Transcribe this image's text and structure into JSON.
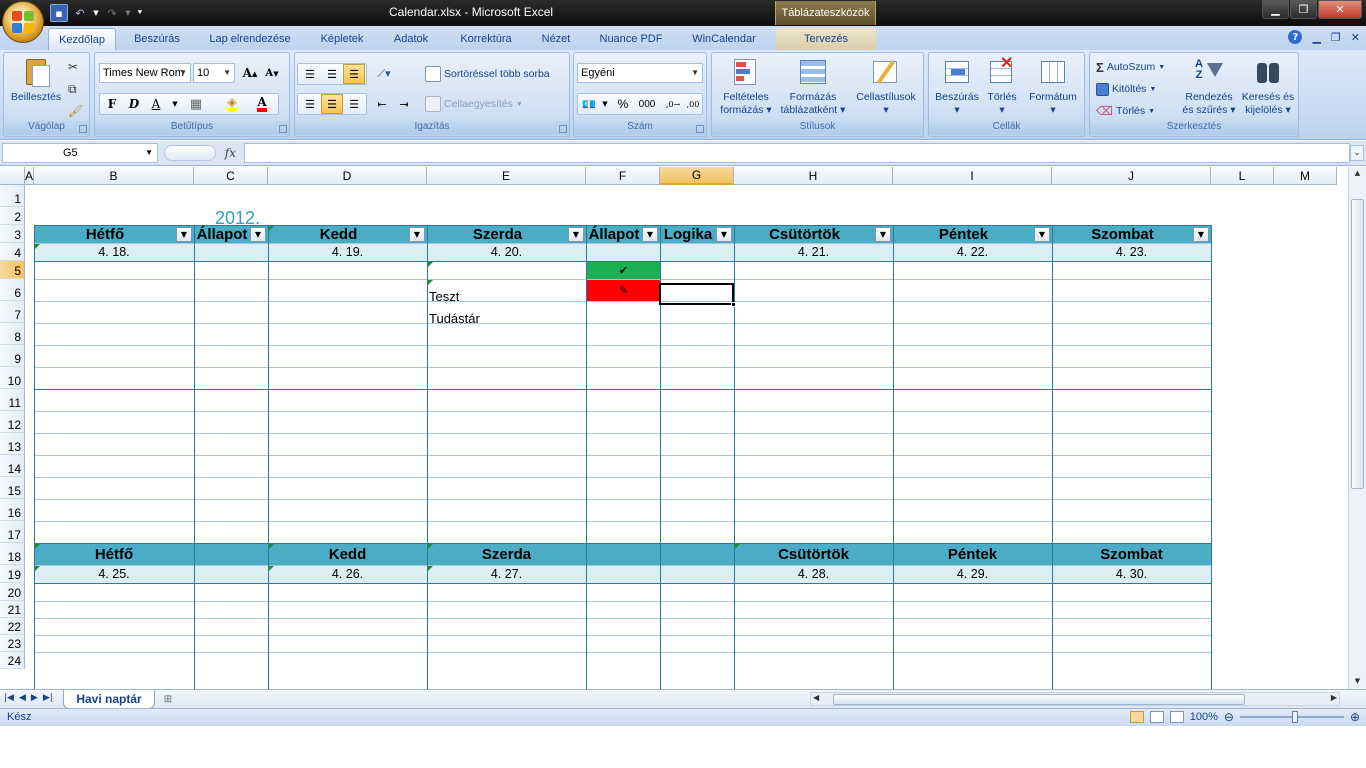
{
  "window": {
    "title": "Calendar.xlsx - Microsoft Excel",
    "context_tab_title": "Táblázateszközök"
  },
  "tabs": [
    {
      "label": "Kezdőlap",
      "active": true
    },
    {
      "label": "Beszúrás"
    },
    {
      "label": "Lap elrendezése"
    },
    {
      "label": "Képletek"
    },
    {
      "label": "Adatok"
    },
    {
      "label": "Korrektúra"
    },
    {
      "label": "Nézet"
    },
    {
      "label": "Nuance PDF"
    },
    {
      "label": "WinCalendar"
    },
    {
      "label": "Tervezés",
      "context": true
    }
  ],
  "ribbon": {
    "clipboard": {
      "label": "Vágólap",
      "paste": "Beillesztés"
    },
    "font": {
      "label": "Betűtípus",
      "font_name": "Times New Rom",
      "font_size": "10",
      "bold": "F",
      "italic": "D",
      "underline": "A"
    },
    "alignment": {
      "label": "Igazítás",
      "wrap": "Sortöréssel több sorba",
      "merge": "Cellaegyesítés"
    },
    "number": {
      "label": "Szám",
      "format": "Egyéni",
      "percent": "%",
      "thousands": "000"
    },
    "styles": {
      "label": "Stílusok",
      "conditional_1": "Feltételes",
      "conditional_2": "formázás",
      "table_1": "Formázás",
      "table_2": "táblázatként",
      "cell_styles": "Cellastílusok"
    },
    "cells": {
      "label": "Cellák",
      "insert": "Beszúrás",
      "delete": "Törlés",
      "format": "Formátum"
    },
    "editing": {
      "label": "Szerkesztés",
      "autosum": "AutoSzum",
      "fill": "Kitöltés",
      "clear": "Törlés",
      "sort_1": "Rendezés",
      "sort_2": "és szűrés",
      "find_1": "Keresés és",
      "find_2": "kijelölés"
    }
  },
  "formula_bar": {
    "name_box": "G5",
    "fx": "fx",
    "value": ""
  },
  "columns": [
    "A",
    "B",
    "C",
    "D",
    "E",
    "F",
    "G",
    "H",
    "I",
    "J",
    "L",
    "M"
  ],
  "rows": [
    "1",
    "2",
    "3",
    "4",
    "5",
    "6",
    "7",
    "8",
    "9",
    "10",
    "11",
    "12",
    "13",
    "14",
    "15",
    "16",
    "17",
    "18",
    "19",
    "20",
    "21",
    "22",
    "23",
    "24"
  ],
  "sheet": {
    "year": "2012.",
    "week1": {
      "headers": [
        "Hétfő",
        "Állapot",
        "Kedd",
        "Szerda",
        "Állapot",
        "Logika",
        "Csütörtök",
        "Péntek",
        "Szombat"
      ],
      "dates": {
        "B": "4. 18.",
        "D": "4. 19.",
        "E": "4. 20.",
        "H": "4. 21.",
        "I": "4. 22.",
        "J": "4. 23."
      },
      "entries": [
        {
          "text": "Teszt",
          "status_color": "#1aaf50",
          "status_icon": "check-icon"
        },
        {
          "text": "Tudástár",
          "status_color": "#ff0000",
          "status_icon": "cross-icon"
        }
      ]
    },
    "week2": {
      "headers": {
        "B": "Hétfő",
        "D": "Kedd",
        "E": "Szerda",
        "H": "Csütörtök",
        "I": "Péntek",
        "J": "Szombat"
      },
      "dates": {
        "B": "4. 25.",
        "D": "4. 26.",
        "E": "4. 27.",
        "H": "4. 28.",
        "I": "4. 29.",
        "J": "4. 30."
      }
    },
    "selected_cell": "G5"
  },
  "sheet_tabs": [
    {
      "label": "Havi naptár",
      "active": true
    }
  ],
  "status": {
    "ready": "Kész",
    "zoom": "100%"
  },
  "colors": {
    "header_band": "#4bacc6",
    "date_band": "#daeef3",
    "grid": "#2b7b98"
  }
}
